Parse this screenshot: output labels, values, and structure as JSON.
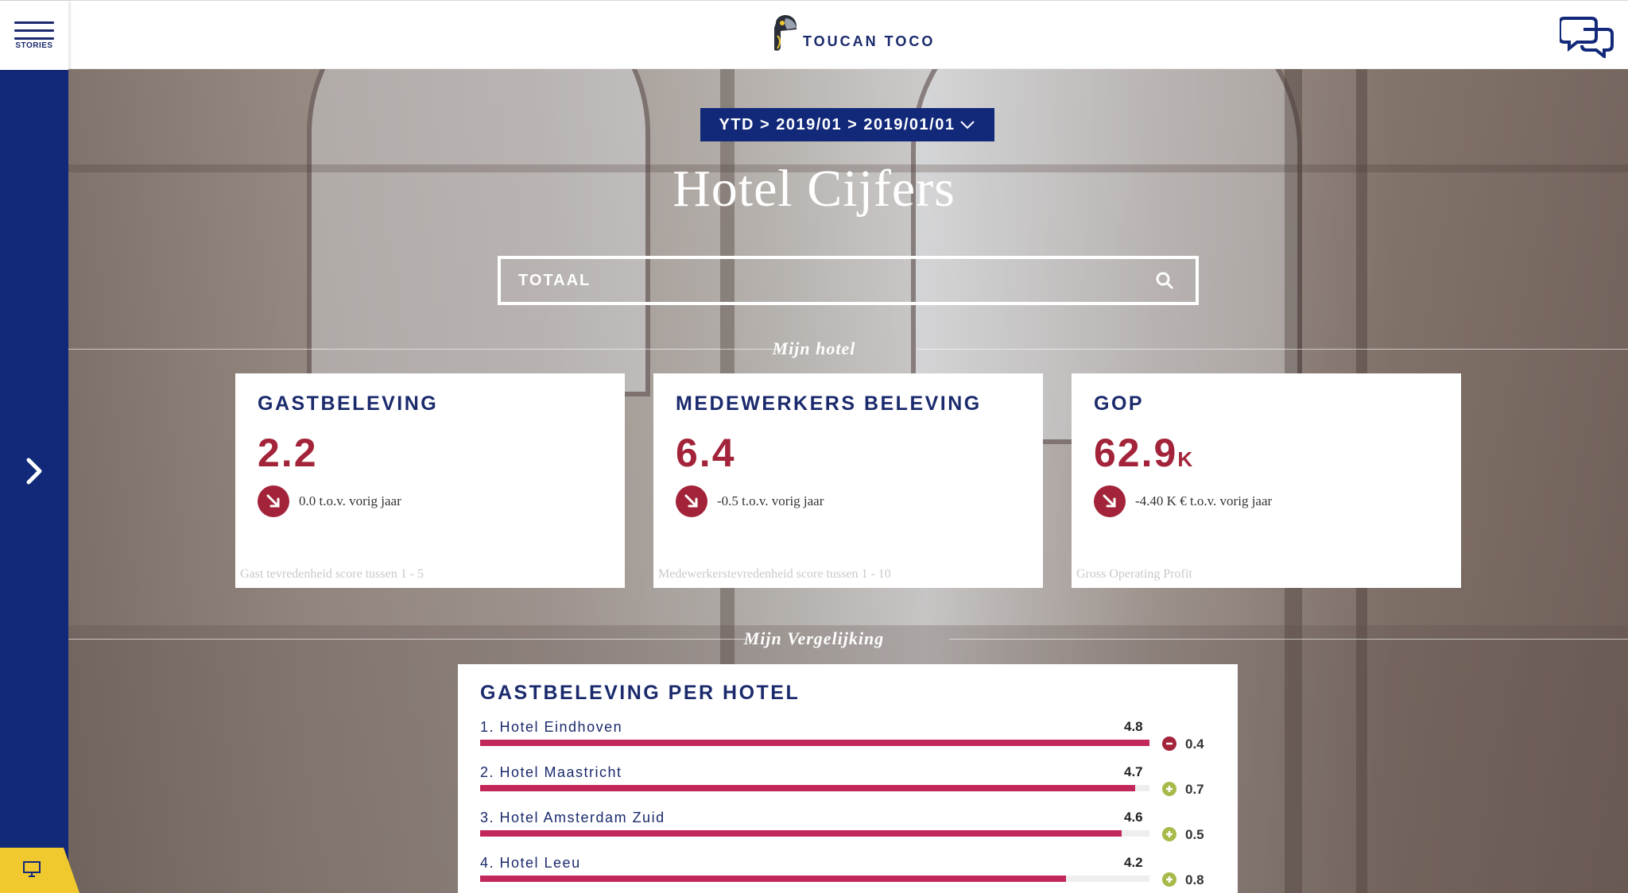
{
  "colors": {
    "navy": "#12297a",
    "accent_red": "#a3243a",
    "bar_pink": "#c2275a",
    "plus_green": "#a8b94a",
    "yellow": "#f0c92e"
  },
  "header": {
    "stories_label": "STORIES",
    "logo_text": "TOUCAN TOCO",
    "chat_icon": "chat-bubbles-icon"
  },
  "breadcrumb": {
    "label": "YTD > 2019/01 > 2019/01/01"
  },
  "title": "Hotel Cijfers",
  "search": {
    "value": "TOTAAL"
  },
  "sections": {
    "mine": "Mijn hotel",
    "comparison": "Mijn Vergelijking"
  },
  "kpis": [
    {
      "title": "GASTBELEVING",
      "value": "2.2",
      "unit": "",
      "trend": "0.0 t.o.v. vorig jaar",
      "description": "Gast tevredenheid score tussen 1 - 5"
    },
    {
      "title": "MEDEWERKERS BELEVING",
      "value": "6.4",
      "unit": "",
      "trend": "-0.5 t.o.v. vorig jaar",
      "description": "Medewerkerstevredenheid score tussen 1 - 10"
    },
    {
      "title": "GOP",
      "value": "62.9",
      "unit": "K",
      "trend": "-4.40 K € t.o.v. vorig jaar",
      "description": "Gross Operating Profit"
    }
  ],
  "ranking": {
    "title": "GASTBELEVING PER HOTEL",
    "max": 4.8,
    "rows": [
      {
        "label": "1. Hotel Eindhoven",
        "value": "4.8",
        "fill": 1.0,
        "delta": "0.4",
        "sign": "minus"
      },
      {
        "label": "2. Hotel Maastricht",
        "value": "4.7",
        "fill": 0.979,
        "delta": "0.7",
        "sign": "plus"
      },
      {
        "label": "3. Hotel Amsterdam Zuid",
        "value": "4.6",
        "fill": 0.958,
        "delta": "0.5",
        "sign": "plus"
      },
      {
        "label": "4. Hotel Leeu",
        "value": "4.2",
        "fill": 0.875,
        "delta": "0.8",
        "sign": "plus"
      }
    ]
  }
}
